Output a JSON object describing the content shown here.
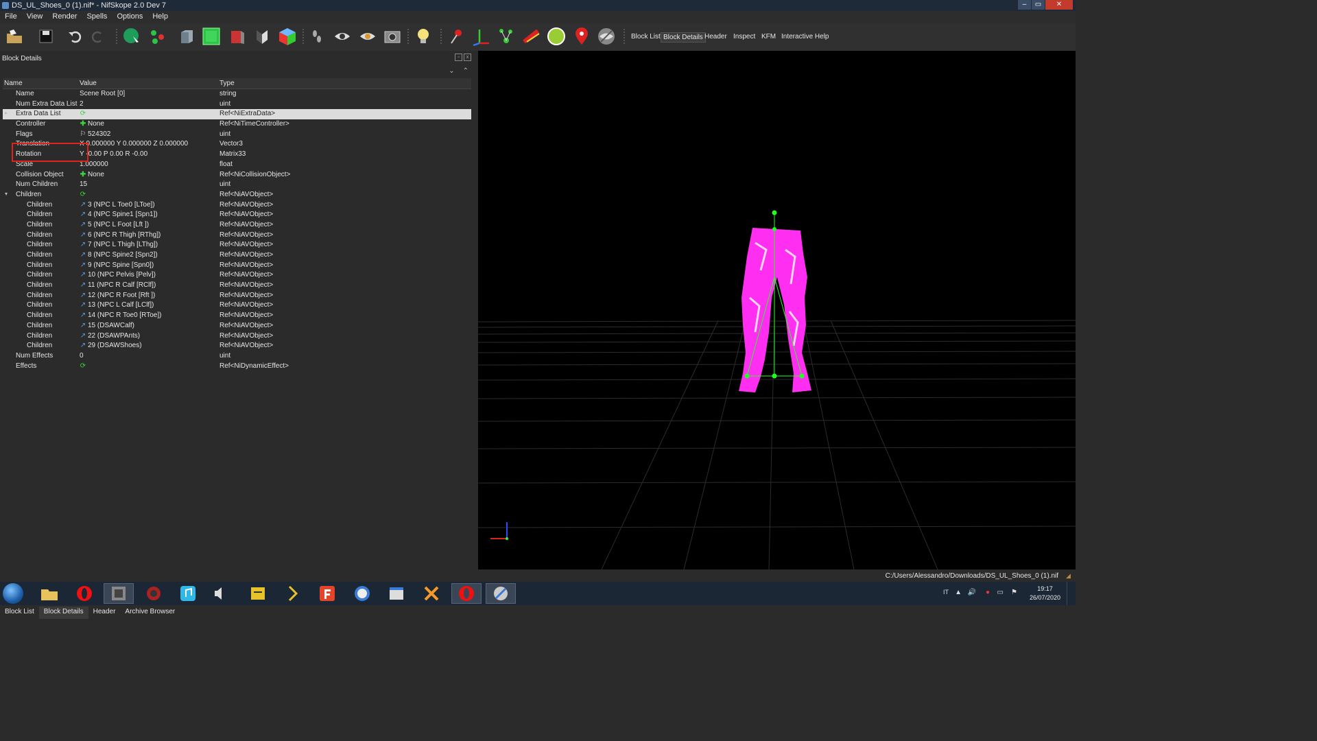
{
  "window": {
    "title": "DS_UL_Shoes_0 (1).nif* - NifSkope 2.0 Dev 7",
    "buttons": [
      "–",
      "▭",
      "✕"
    ]
  },
  "menu": [
    "File",
    "View",
    "Render",
    "Spells",
    "Options",
    "Help"
  ],
  "toolbar": {
    "icons": [
      "open-icon",
      "save-icon",
      "undo-icon",
      "redo-icon",
      "select-object-icon",
      "select-vertex-icon",
      "box-view-icon",
      "front-view-icon",
      "side-view-icon",
      "flip-view-icon",
      "texture-cube-icon",
      "walk-icon",
      "eye-icon",
      "eye-toggle-icon",
      "screenshot-icon",
      "light-icon",
      "pin-icon",
      "axes-icon",
      "nodes-icon",
      "constraints-icon",
      "globe-icon",
      "marker-icon",
      "hide-icon"
    ],
    "text_buttons": [
      "Block List",
      "Block Details",
      "Header",
      "Inspect",
      "KFM",
      "Interactive Help"
    ],
    "active_text": "Block Details"
  },
  "panel": {
    "title": "Block Details",
    "dock_buttons": [
      "▫",
      "x"
    ],
    "scroll_buttons": [
      "⌄",
      "⌃"
    ],
    "columns": [
      "Name",
      "Value",
      "Type"
    ],
    "rows": [
      {
        "name": "Name",
        "value": "Scene Root [0]",
        "type": "string",
        "icon": ""
      },
      {
        "name": "Num Extra Data List",
        "value": "2",
        "type": "uint",
        "icon": ""
      },
      {
        "name": "Extra Data List",
        "value": "",
        "type": "Ref<NiExtraData>",
        "icon": "cycle",
        "expander": "▸"
      },
      {
        "name": "Controller",
        "value": "None",
        "type": "Ref<NiTimeController>",
        "icon": "plus"
      },
      {
        "name": "Flags",
        "value": "524302",
        "type": "uint",
        "icon": "flag"
      },
      {
        "name": "Translation",
        "value": "X 0.000000 Y 0.000000 Z 0.000000",
        "type": "Vector3",
        "icon": ""
      },
      {
        "name": "Rotation",
        "value": "Y -0.00 P 0.00 R -0.00",
        "type": "Matrix33",
        "icon": ""
      },
      {
        "name": "Scale",
        "value": "1.000000",
        "type": "float",
        "icon": ""
      },
      {
        "name": "Collision Object",
        "value": "None",
        "type": "Ref<NiCollisionObject>",
        "icon": "plus"
      },
      {
        "name": "Num Children",
        "value": "15",
        "type": "uint",
        "icon": ""
      },
      {
        "name": "Children",
        "value": "",
        "type": "Ref<NiAVObject>",
        "icon": "cycle",
        "expander": "▾"
      },
      {
        "name": "Children",
        "value": "3 (NPC L Toe0 [LToe])",
        "type": "Ref<NiAVObject>",
        "icon": "link",
        "indent": true
      },
      {
        "name": "Children",
        "value": "4 (NPC Spine1 [Spn1])",
        "type": "Ref<NiAVObject>",
        "icon": "link",
        "indent": true
      },
      {
        "name": "Children",
        "value": "5 (NPC L Foot [Lft ])",
        "type": "Ref<NiAVObject>",
        "icon": "link",
        "indent": true
      },
      {
        "name": "Children",
        "value": "6 (NPC R Thigh [RThg])",
        "type": "Ref<NiAVObject>",
        "icon": "link",
        "indent": true
      },
      {
        "name": "Children",
        "value": "7 (NPC L Thigh [LThg])",
        "type": "Ref<NiAVObject>",
        "icon": "link",
        "indent": true
      },
      {
        "name": "Children",
        "value": "8 (NPC Spine2 [Spn2])",
        "type": "Ref<NiAVObject>",
        "icon": "link",
        "indent": true
      },
      {
        "name": "Children",
        "value": "9 (NPC Spine [Spn0])",
        "type": "Ref<NiAVObject>",
        "icon": "link",
        "indent": true
      },
      {
        "name": "Children",
        "value": "10 (NPC Pelvis [Pelv])",
        "type": "Ref<NiAVObject>",
        "icon": "link",
        "indent": true
      },
      {
        "name": "Children",
        "value": "11 (NPC R Calf [RClf])",
        "type": "Ref<NiAVObject>",
        "icon": "link",
        "indent": true
      },
      {
        "name": "Children",
        "value": "12 (NPC R Foot [Rft ])",
        "type": "Ref<NiAVObject>",
        "icon": "link",
        "indent": true
      },
      {
        "name": "Children",
        "value": "13 (NPC L Calf [LClf])",
        "type": "Ref<NiAVObject>",
        "icon": "link",
        "indent": true
      },
      {
        "name": "Children",
        "value": "14 (NPC R Toe0 [RToe])",
        "type": "Ref<NiAVObject>",
        "icon": "link",
        "indent": true
      },
      {
        "name": "Children",
        "value": "15 (DSAWCalf)",
        "type": "Ref<NiAVObject>",
        "icon": "link",
        "indent": true
      },
      {
        "name": "Children",
        "value": "22 (DSAWPAnts)",
        "type": "Ref<NiAVObject>",
        "icon": "link",
        "indent": true
      },
      {
        "name": "Children",
        "value": "29 (DSAWShoes)",
        "type": "Ref<NiAVObject>",
        "icon": "link",
        "indent": true
      },
      {
        "name": "Num Effects",
        "value": "0",
        "type": "uint",
        "icon": ""
      },
      {
        "name": "Effects",
        "value": "",
        "type": "Ref<NiDynamicEffect>",
        "icon": "cycle"
      }
    ],
    "selected_row": 2,
    "tabs": [
      "Block List",
      "Block Details",
      "Header",
      "Archive Browser"
    ],
    "active_tab": "Block Details"
  },
  "viewport": {
    "model": "pants-mesh",
    "mesh_color": "#ff2ef0",
    "skeleton_color": "#22ff22",
    "background": "#000000"
  },
  "status": {
    "path": "C:/Users/Alessandro/Downloads/DS_UL_Shoes_0 (1).nif"
  },
  "taskbar": {
    "apps": [
      "explorer-icon",
      "opera-icon",
      "media-icon",
      "game-icon",
      "music-icon",
      "audio-icon",
      "folder-app-icon",
      "arrow-app-icon",
      "foxit-icon",
      "ffdec-icon",
      "window-app-icon",
      "tools-icon",
      "opera-active-icon",
      "nifskope-icon"
    ],
    "language": "IT",
    "time": "19:17",
    "date": "26/07/2020"
  },
  "colors": {
    "accent_red": "#e2231a",
    "selected_row": "#dcdcdc",
    "panel_bg": "#2b2b2b"
  }
}
